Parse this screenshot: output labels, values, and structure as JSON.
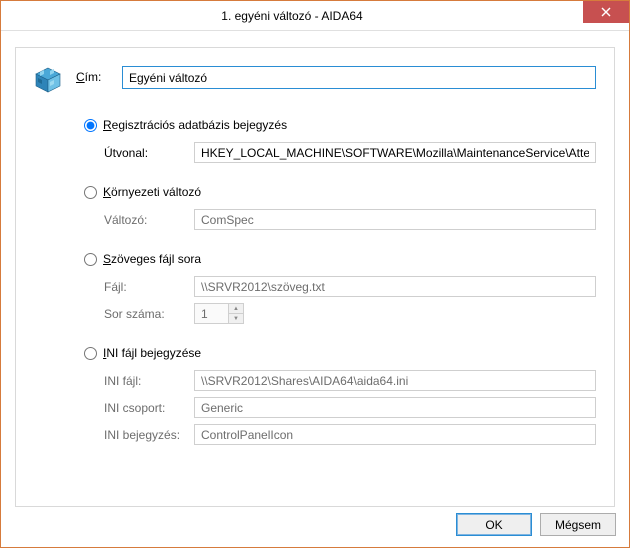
{
  "window": {
    "title": "1. egyéni változó - AIDA64",
    "close_aria": "Close"
  },
  "header": {
    "title_label_pre": "C",
    "title_label_rest": "ím:",
    "title_value": "Egyéni változó"
  },
  "registry": {
    "radio_pre": "R",
    "radio_rest": "egisztrációs adatbázis bejegyzés",
    "path_label": "Útvonal:",
    "path_value": "HKEY_LOCAL_MACHINE\\SOFTWARE\\Mozilla\\MaintenanceService\\Attented"
  },
  "env": {
    "radio_pre": "K",
    "radio_rest": "örnyezeti változó",
    "var_label": "Változó:",
    "var_value": "ComSpec"
  },
  "textfile": {
    "radio_pre": "S",
    "radio_rest": "zöveges fájl sora",
    "file_label": "Fájl:",
    "file_value": "\\\\SRVR2012\\szöveg.txt",
    "line_label": "Sor száma:",
    "line_value": "1"
  },
  "ini": {
    "radio_pre": "I",
    "radio_rest": "NI fájl bejegyzése",
    "file_label": "INI fájl:",
    "file_value": "\\\\SRVR2012\\Shares\\AIDA64\\aida64.ini",
    "group_label": "INI csoport:",
    "group_value": "Generic",
    "entry_label": "INI bejegyzés:",
    "entry_value": "ControlPanelIcon"
  },
  "buttons": {
    "ok": "OK",
    "cancel": "Mégsem"
  }
}
